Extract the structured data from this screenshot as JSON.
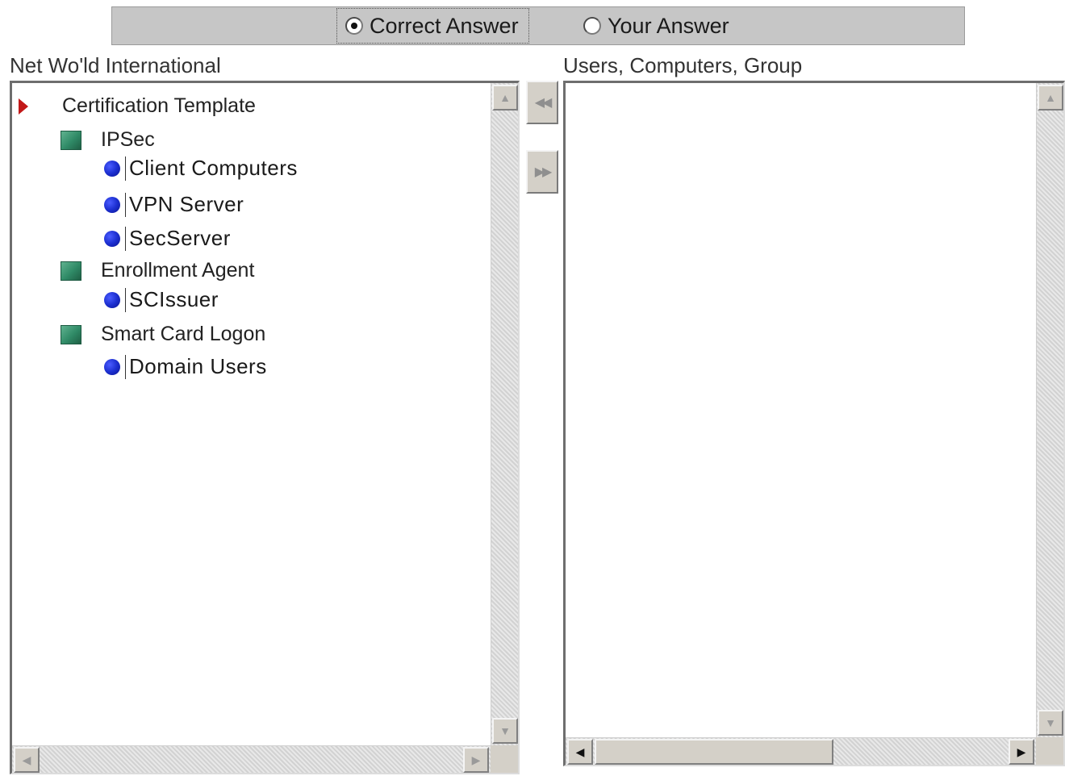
{
  "answer_toggle": {
    "options": [
      {
        "label": "Correct Answer",
        "selected": true
      },
      {
        "label": "Your Answer",
        "selected": false
      }
    ]
  },
  "left_panel": {
    "heading": "Net Wo'ld International",
    "tree": {
      "root": "Certification Template",
      "templates": [
        {
          "label": "IPSec",
          "members": [
            "Client Computers",
            "VPN Server",
            "SecServer"
          ]
        },
        {
          "label": "Enrollment Agent",
          "members": [
            "SCIssuer"
          ]
        },
        {
          "label": "Smart Card Logon",
          "members": [
            "Domain Users"
          ]
        }
      ]
    }
  },
  "right_panel": {
    "heading": "Users, Computers, Group",
    "items": []
  },
  "icons": {
    "root": "red-arrow-icon",
    "template": "green-square-icon",
    "member": "blue-dot-icon",
    "move_left": "double-left-arrow-icon",
    "move_right": "double-right-arrow-icon"
  },
  "colors": {
    "toolbar_bg": "#c6c6c6",
    "root_arrow": "#c21818",
    "template_icon": "#2f8a66",
    "member_icon": "#1c2fd0"
  }
}
